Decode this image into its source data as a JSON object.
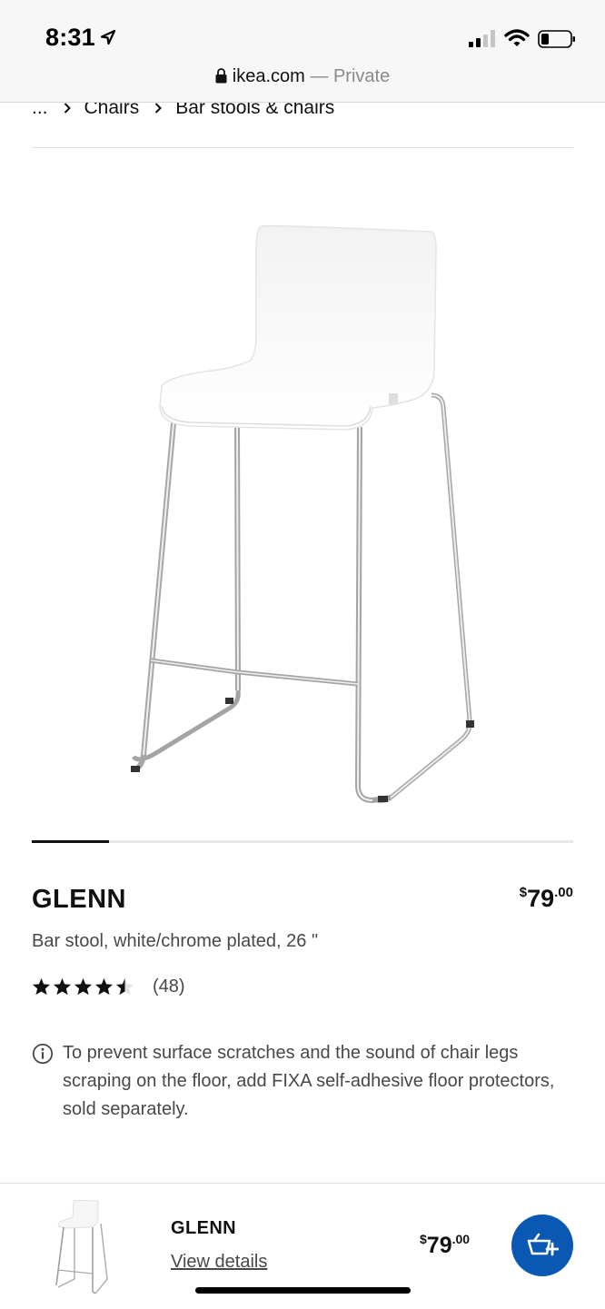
{
  "status_bar": {
    "time": "8:31"
  },
  "url_bar": {
    "domain": "ikea.com",
    "separator": "—",
    "mode": "Private"
  },
  "breadcrumb": {
    "ellipsis": "...",
    "items": [
      "Chairs",
      "Bar stools & chairs"
    ]
  },
  "carousel": {
    "current_index": 1
  },
  "product": {
    "name": "GLENN",
    "price_currency": "$",
    "price_int": "79",
    "price_decimal": ".00",
    "description": "Bar stool, white/chrome plated, 26 \"",
    "rating": 4.5,
    "review_count": "(48)",
    "note": "To prevent surface scratches and the sound of chair legs scraping on the floor, add FIXA self-adhesive floor protectors, sold separately."
  },
  "sticky_bar": {
    "name": "GLENN",
    "link_label": "View details",
    "price_currency": "$",
    "price_int": "79",
    "price_decimal": ".00",
    "cart_icon": "add-to-basket-icon"
  },
  "colors": {
    "accent_blue": "#0a58b3",
    "text": "#111111",
    "text_secondary": "#484848"
  }
}
